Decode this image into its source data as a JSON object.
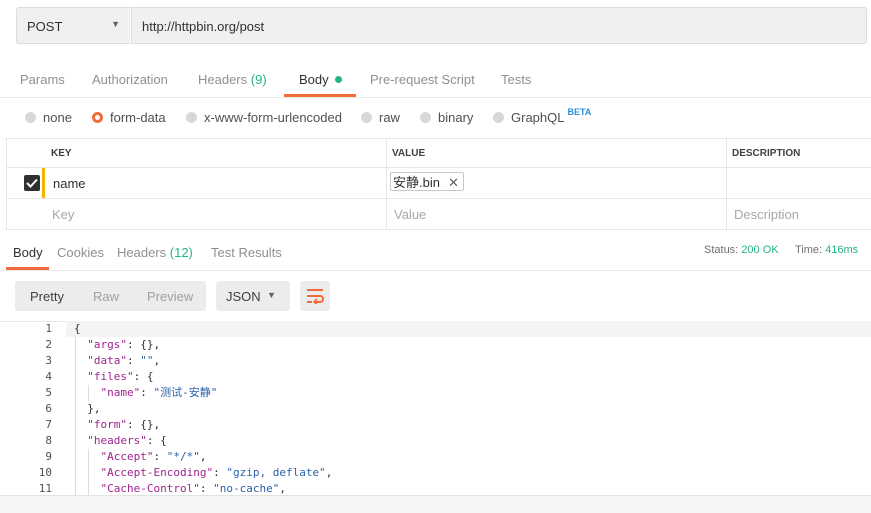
{
  "request": {
    "method": "POST",
    "url": "http://httpbin.org/post",
    "tabs": [
      {
        "label": "Params"
      },
      {
        "label": "Authorization"
      },
      {
        "label": "Headers",
        "count": "(9)"
      },
      {
        "label": "Body"
      },
      {
        "label": "Pre-request Script"
      },
      {
        "label": "Tests"
      }
    ],
    "active_tab": "Body",
    "body_types": [
      "none",
      "form-data",
      "x-www-form-urlencoded",
      "raw",
      "binary",
      "GraphQL"
    ],
    "selected_body_type": "form-data",
    "graphql_badge": "BETA",
    "table": {
      "headers": [
        "KEY",
        "VALUE",
        "DESCRIPTION"
      ],
      "rows": [
        {
          "checked": true,
          "key": "name",
          "value_file": "安静.bin",
          "description": ""
        }
      ],
      "placeholder": {
        "key": "Key",
        "value": "Value",
        "description": "Description"
      }
    }
  },
  "response": {
    "tabs": [
      {
        "label": "Body"
      },
      {
        "label": "Cookies"
      },
      {
        "label": "Headers",
        "count": "(12)"
      },
      {
        "label": "Test Results"
      }
    ],
    "active_tab": "Body",
    "status_label": "Status:",
    "status_value": "200 OK",
    "time_label": "Time:",
    "time_value": "416ms",
    "format_buttons": [
      "Pretty",
      "Raw",
      "Preview"
    ],
    "active_format": "Pretty",
    "language": "JSON",
    "line_numbers": [
      "1",
      "2",
      "3",
      "4",
      "5",
      "6",
      "7",
      "8",
      "9",
      "10",
      "11"
    ],
    "code_lines": [
      "{",
      "  \"args\": {},",
      "  \"data\": \"\",",
      "  \"files\": {",
      "    \"name\": \"测试-安静\"",
      "  },",
      "  \"form\": {},",
      "  \"headers\": {",
      "    \"Accept\": \"*/*\",",
      "    \"Accept-Encoding\": \"gzip, deflate\",",
      "    \"Cache-Control\": \"no-cache\","
    ]
  },
  "icons": {
    "method_caret": "chevron-down-icon",
    "file_remove": "close-icon",
    "row_checkbox": "checkbox-checked-icon",
    "wrap_toggle": "wrap-lines-icon"
  },
  "colors": {
    "accent": "#f26b3a",
    "success": "#26b47f",
    "row_marker": "#f2b705",
    "beta": "#2f8fd8"
  }
}
